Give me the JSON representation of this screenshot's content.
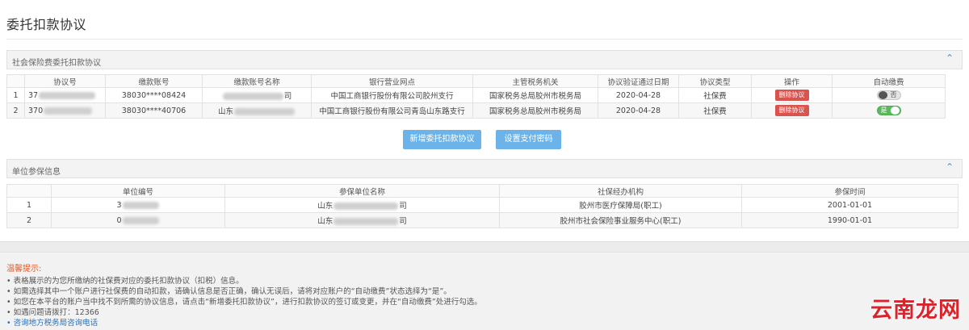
{
  "page": {
    "title": "委托扣款协议"
  },
  "agreements": {
    "panel_title": "社会保险费委托扣款协议",
    "columns": [
      "协议号",
      "缴款账号",
      "缴款账号名称",
      "银行营业网点",
      "主管税务机关",
      "协议验证通过日期",
      "协议类型",
      "操作",
      "自动缴费"
    ],
    "rows": [
      {
        "no": "1",
        "agreement_prefix": "37",
        "account": "38030****08424",
        "account_name_suffix": "司",
        "bank": "中国工商银行股份有限公司胶州支行",
        "tax_office": "国家税务总局胶州市税务局",
        "date": "2020-04-28",
        "type": "社保费",
        "action": "删除协议",
        "auto": "否",
        "auto_on": false
      },
      {
        "no": "2",
        "agreement_prefix": "370",
        "account": "38030****40706",
        "account_name_suffix": "山东",
        "bank": "中国工商银行股份有限公司青岛山东路支行",
        "tax_office": "国家税务总局胶州市税务局",
        "date": "2020-04-28",
        "type": "社保费",
        "action": "删除协议",
        "auto": "是",
        "auto_on": true
      }
    ],
    "buttons": {
      "add": "新增委托扣款协议",
      "password": "设置支付密码"
    }
  },
  "units": {
    "panel_title": "单位参保信息",
    "columns": [
      "单位编号",
      "参保单位名称",
      "社保经办机构",
      "参保时间"
    ],
    "rows": [
      {
        "no": "1",
        "unit_no": "3",
        "name_prefix": "山东",
        "name_suffix": "司",
        "agency": "胶州市医疗保障局(职工)",
        "date": "2001-01-01"
      },
      {
        "no": "2",
        "unit_no": "0",
        "name_prefix": "山东",
        "name_suffix": "司",
        "agency": "胶州市社会保险事业服务中心(职工)",
        "date": "1990-01-01"
      }
    ]
  },
  "tips": {
    "title": "温馨提示:",
    "lines": [
      "• 表格展示的为您所缴纳的社保费对应的委托扣款协议（扣税）信息。",
      "• 如需选择其中一个账户进行社保费的自动扣款，请确认信息是否正确，确认无误后，请将对应账户的“自动缴费”状态选择为“是”。",
      "• 如您在本平台的账户当中找不到所需的协议信息，请点击“新增委托扣款协议”，进行扣款协议的签订或变更，并在“自动缴费”处进行勾选。",
      "• 如遇问题请拨打：12366",
      "• 咨询地方税务局咨询电话"
    ]
  },
  "watermark": "云南龙网"
}
